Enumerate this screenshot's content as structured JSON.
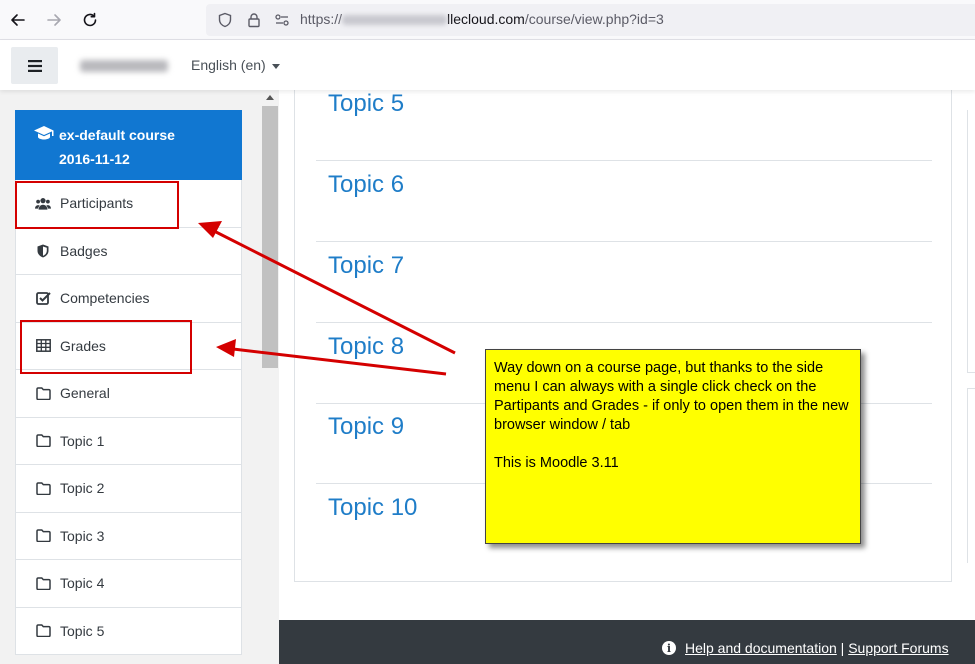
{
  "browser": {
    "url_prefix": "https://",
    "url_host_visible": "llecloud.com",
    "url_path": "/course/view.php?id=3"
  },
  "navbar": {
    "language_label": "English (en)"
  },
  "drawer": {
    "course_title_line1": "ex-default course",
    "course_title_line2": "2016-11-12",
    "items": [
      {
        "label": "Participants",
        "icon": "users-icon"
      },
      {
        "label": "Badges",
        "icon": "shield-icon"
      },
      {
        "label": "Competencies",
        "icon": "check-square-icon"
      },
      {
        "label": "Grades",
        "icon": "table-icon"
      },
      {
        "label": "General",
        "icon": "folder-icon"
      },
      {
        "label": "Topic 1",
        "icon": "folder-icon"
      },
      {
        "label": "Topic 2",
        "icon": "folder-icon"
      },
      {
        "label": "Topic 3",
        "icon": "folder-icon"
      },
      {
        "label": "Topic 4",
        "icon": "folder-icon"
      },
      {
        "label": "Topic 5",
        "icon": "folder-icon"
      }
    ]
  },
  "main": {
    "topics": [
      "Topic 5",
      "Topic 6",
      "Topic 7",
      "Topic 8",
      "Topic 9",
      "Topic 10"
    ]
  },
  "footer": {
    "help_link": "Help and documentation",
    "separator": "|",
    "support_link": "Support Forums"
  },
  "annotation": {
    "note_text": "Way down on a course page, but thanks to the side menu I can always with a single click check on the Partipants and Grades - if only to open them in the new browser window / tab",
    "note_text2": "This is Moodle 3.11"
  },
  "colors": {
    "accent": "#1177d1",
    "topic_link": "#1f7dc8",
    "note_bg": "#ffff00",
    "annotation_red": "#d40000",
    "footer_bg": "#343a40"
  }
}
